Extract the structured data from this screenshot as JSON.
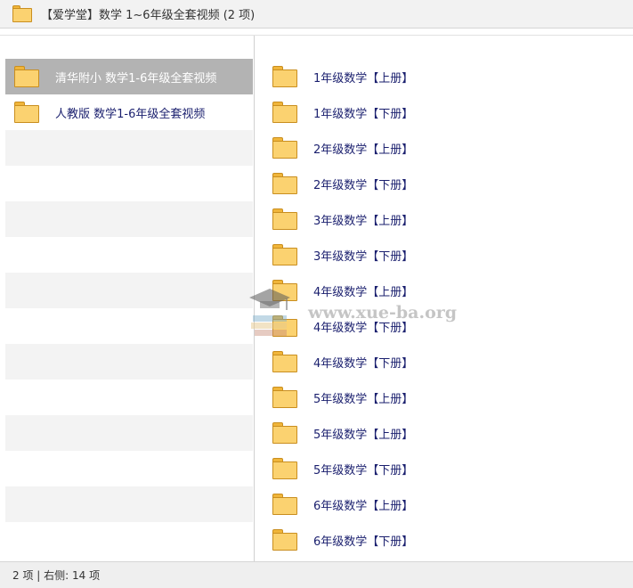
{
  "window": {
    "title": "【爱学堂】数学 1~6年级全套视频 (2 项)",
    "folder_icon": "folder-icon"
  },
  "left_pane": {
    "items": [
      {
        "label": "清华附小  数学1-6年级全套视频",
        "selected": true
      },
      {
        "label": "人教版  数学1-6年级全套视频",
        "selected": false
      }
    ]
  },
  "right_pane": {
    "items": [
      {
        "label": "1年级数学【上册】"
      },
      {
        "label": "1年级数学【下册】"
      },
      {
        "label": "2年级数学【上册】"
      },
      {
        "label": "2年级数学【下册】"
      },
      {
        "label": "3年级数学【上册】"
      },
      {
        "label": "3年级数学【下册】"
      },
      {
        "label": "4年级数学【上册】"
      },
      {
        "label": "4年级数学【下册】"
      },
      {
        "label": "4年级数学【下册】"
      },
      {
        "label": "5年级数学【上册】"
      },
      {
        "label": "5年级数学【上册】"
      },
      {
        "label": "5年级数学【下册】"
      },
      {
        "label": "6年级数学【上册】"
      },
      {
        "label": "6年级数学【下册】"
      }
    ]
  },
  "watermark": {
    "text": "www.xue-ba.org"
  },
  "status": {
    "text": "2 项 | 右侧: 14 项"
  },
  "colors": {
    "selected_row": "#b3b3b3",
    "alt_row": "#f3f3f3",
    "label_text": "#1a1f6e",
    "folder_fill": "#fbd270"
  }
}
